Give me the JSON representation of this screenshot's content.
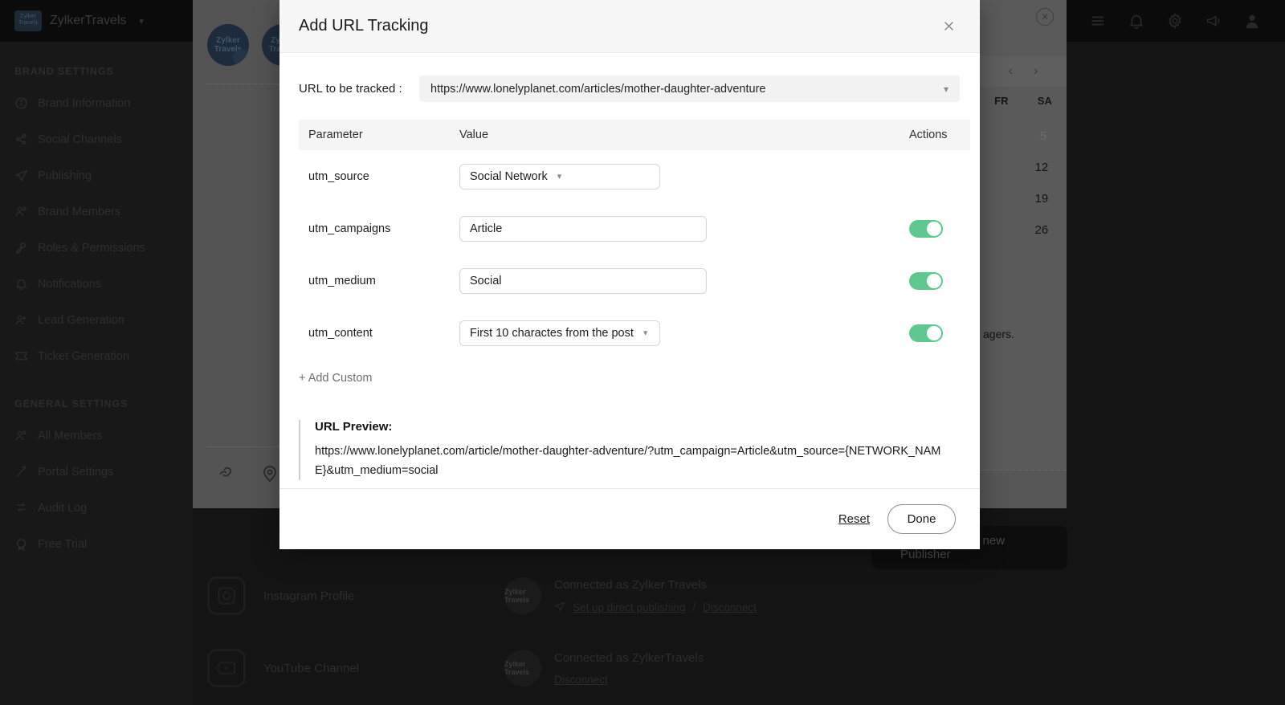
{
  "background": {
    "topnav": {
      "brand_logo_text": "Zylker Travels",
      "brand_name": "ZylkerTravels",
      "caret_icon": "chevron-down-icon",
      "icons": [
        "menu-icon",
        "bell-icon",
        "gear-icon",
        "megaphone-icon",
        "avatar-icon"
      ]
    },
    "sidebar": {
      "section_brand": "BRAND SETTINGS",
      "brand_items": [
        {
          "label": "Brand Information",
          "icon": "info-icon"
        },
        {
          "label": "Social Channels",
          "icon": "share-icon"
        },
        {
          "label": "Publishing",
          "icon": "send-icon"
        },
        {
          "label": "Brand Members",
          "icon": "users-icon"
        },
        {
          "label": "Roles & Permissions",
          "icon": "key-icon"
        },
        {
          "label": "Notifications",
          "icon": "bell-icon"
        },
        {
          "label": "Lead Generation",
          "icon": "user-plus-icon"
        },
        {
          "label": "Ticket Generation",
          "icon": "ticket-icon"
        }
      ],
      "section_general": "GENERAL SETTINGS",
      "general_items": [
        {
          "label": "All Members",
          "icon": "users-icon"
        },
        {
          "label": "Portal Settings",
          "icon": "sliders-icon"
        },
        {
          "label": "Audit Log",
          "icon": "list-icon"
        },
        {
          "label": "Free Trial",
          "icon": "badge-icon"
        }
      ]
    },
    "avatars": [
      {
        "text": "Zylker Travels"
      },
      {
        "text": "Zylker Travels"
      }
    ],
    "tool_icons": [
      "link-icon",
      "location-pin-icon"
    ],
    "calendar": {
      "close_icon": "close-circle-icon",
      "prev_icon": "chevron-left-icon",
      "next_icon": "chevron-right-icon",
      "day_headers": [
        "FR",
        "SA"
      ],
      "weeks": [
        [
          "",
          "5"
        ],
        [
          "",
          "12"
        ],
        [
          "",
          "19"
        ],
        [
          "",
          "26"
        ]
      ],
      "note": "agers."
    },
    "channels": [
      {
        "name": "Instagram Profile",
        "icon": "instagram-icon",
        "avatar_text": "Zylker Travels",
        "connected_as": "Connected as Zylker Travels",
        "action_primary": "Set up direct publishing",
        "action_separator": "/",
        "action_secondary": "Disconnect",
        "action_icon": "send-icon"
      },
      {
        "name": "YouTube Channel",
        "icon": "youtube-icon",
        "avatar_text": "Zylker Travels",
        "connected_as": "Connected as ZylkerTravels",
        "action_primary": "",
        "action_separator": "",
        "action_secondary": "Disconnect",
        "action_icon": ""
      }
    ],
    "publisher_tip": {
      "label": "Connect to our new Publisher",
      "icon": "plus-icon"
    }
  },
  "modal": {
    "title": "Add URL Tracking",
    "close_icon": "close-icon",
    "url_field": {
      "label": "URL to be tracked :",
      "value": "https://www.lonelyplanet.com/articles/mother-daughter-adventure",
      "chevron_icon": "chevron-down-icon"
    },
    "table": {
      "headers": {
        "parameter": "Parameter",
        "value": "Value",
        "actions": "Actions"
      },
      "rows": [
        {
          "parameter": "utm_source",
          "value": "Social Network",
          "control": "select",
          "width": "w250",
          "toggle": null
        },
        {
          "parameter": "utm_campaigns",
          "value": "Article",
          "control": "input",
          "width": "w308",
          "toggle": "on"
        },
        {
          "parameter": "utm_medium",
          "value": "Social",
          "control": "input",
          "width": "w308",
          "toggle": "on"
        },
        {
          "parameter": "utm_content",
          "value": "First 10 charactes from the post",
          "control": "select",
          "width": "w250",
          "toggle": "on"
        }
      ]
    },
    "add_custom_label": "+ Add Custom",
    "preview": {
      "title": "URL Preview:",
      "url": "https://www.lonelyplanet.com/article/mother-daughter-adventure/?utm_campaign=Article&utm_source={NETWORK_NAME}&utm_medium=social"
    },
    "footer": {
      "reset_label": "Reset",
      "done_label": "Done"
    }
  },
  "colors": {
    "toggle_on": "#5ec88e",
    "modal_bg": "#ffffff",
    "header_bg": "#f7f7f7",
    "table_header_bg": "#f5f5f5"
  }
}
